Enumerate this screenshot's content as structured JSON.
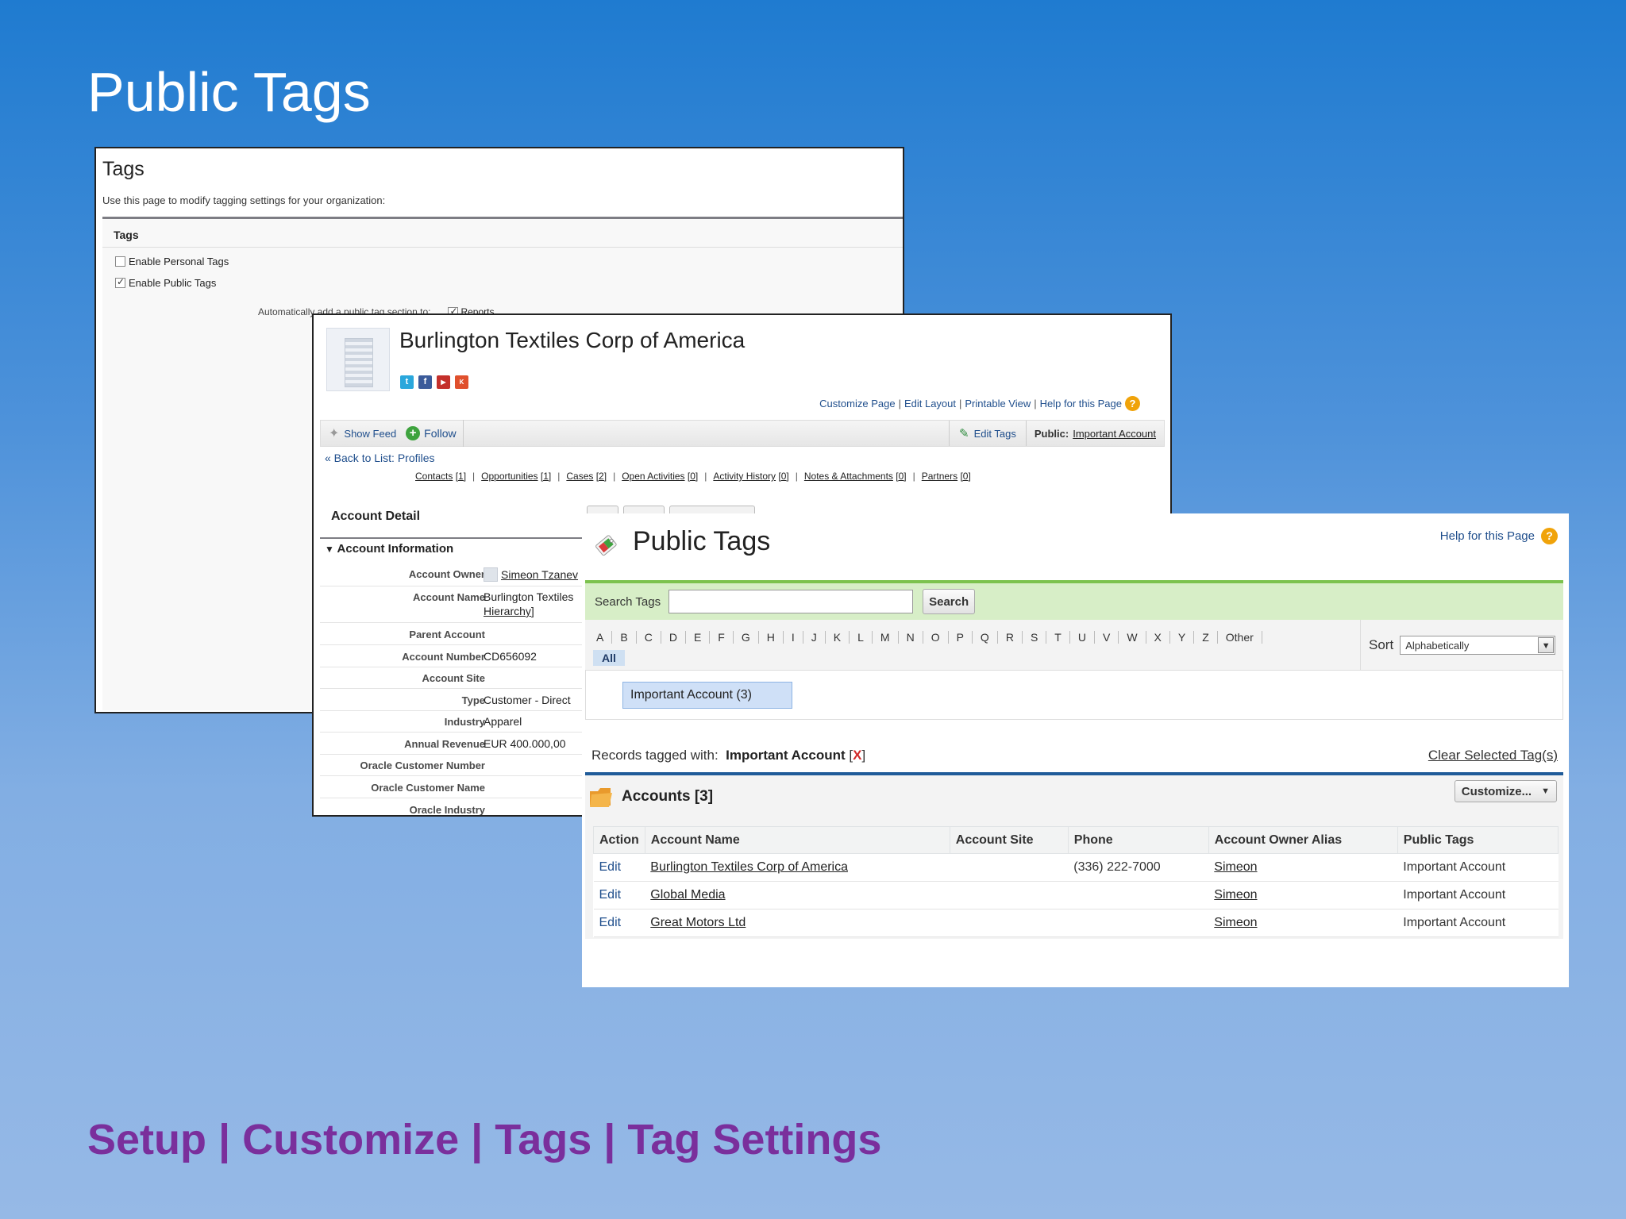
{
  "slide": {
    "title": "Public Tags",
    "footer": "Setup | Customize | Tags | Tag Settings"
  },
  "tag_settings": {
    "title": "Tags",
    "intro": "Use this page to modify tagging settings for your organization:",
    "section": "Tags",
    "personal_label": "Enable Personal Tags",
    "personal_checked": false,
    "public_label": "Enable Public Tags",
    "public_checked": true,
    "auto_label": "Automatically add a public tag section to:",
    "reports_label": "Reports",
    "reports_checked": true
  },
  "account": {
    "name": "Burlington Textiles Corp of America",
    "links": [
      "Customize Page",
      "Edit Layout",
      "Printable View",
      "Help for this Page"
    ],
    "show_feed": "Show Feed",
    "follow": "Follow",
    "edit_tags": "Edit Tags",
    "public_label": "Public:",
    "public_tag": "Important Account",
    "back_to_list": "« Back to List: Profiles",
    "related": [
      {
        "label": "Contacts",
        "count": "[1]"
      },
      {
        "label": "Opportunities",
        "count": "[1]"
      },
      {
        "label": "Cases",
        "count": "[2]"
      },
      {
        "label": "Open Activities",
        "count": "[0]"
      },
      {
        "label": "Activity History",
        "count": "[0]"
      },
      {
        "label": "Notes & Attachments",
        "count": "[0]"
      },
      {
        "label": "Partners",
        "count": "[0]"
      }
    ],
    "detail_title": "Account Detail",
    "info_title": "Account Information",
    "fields": [
      {
        "label": "Account Owner",
        "value": "Simeon Tzanev"
      },
      {
        "label": "Account Name",
        "value": "Burlington Textiles",
        "value2": "Hierarchy]"
      },
      {
        "label": "Parent Account",
        "value": ""
      },
      {
        "label": "Account Number",
        "value": "CD656092"
      },
      {
        "label": "Account Site",
        "value": ""
      },
      {
        "label": "Type",
        "value": "Customer - Direct"
      },
      {
        "label": "Industry",
        "value": "Apparel"
      },
      {
        "label": "Annual Revenue",
        "value": "EUR 400.000,00"
      },
      {
        "label": "Oracle Customer Number",
        "value": ""
      },
      {
        "label": "Oracle Customer Name",
        "value": ""
      },
      {
        "label": "Oracle Industry",
        "value": ""
      }
    ]
  },
  "public_tags": {
    "title": "Public Tags",
    "help": "Help for this Page",
    "search_label": "Search Tags",
    "search_value": "",
    "search_button": "Search",
    "letters": [
      "A",
      "B",
      "C",
      "D",
      "E",
      "F",
      "G",
      "H",
      "I",
      "J",
      "K",
      "L",
      "M",
      "N",
      "O",
      "P",
      "Q",
      "R",
      "S",
      "T",
      "U",
      "V",
      "W",
      "X",
      "Y",
      "Z",
      "Other"
    ],
    "all_label": "All",
    "sort_label": "Sort",
    "sort_value": "Alphabetically",
    "tag_chip": "Important Account (3)",
    "records_label": "Records tagged with:",
    "records_tag": "Important Account",
    "records_open": "[",
    "records_x": "X",
    "records_close": "]",
    "clear_label": "Clear Selected Tag(s)",
    "list_title": "Accounts [3]",
    "customize_label": "Customize...",
    "columns": [
      "Action",
      "Account Name",
      "Account Site",
      "Phone",
      "Account Owner Alias",
      "Public Tags"
    ],
    "rows": [
      {
        "action": "Edit",
        "name": "Burlington Textiles Corp of America",
        "site": "",
        "phone": "(336) 222-7000",
        "owner": "Simeon",
        "tags": "Important Account"
      },
      {
        "action": "Edit",
        "name": "Global Media",
        "site": "",
        "phone": "",
        "owner": "Simeon",
        "tags": "Important Account"
      },
      {
        "action": "Edit",
        "name": "Great Motors Ltd",
        "site": "",
        "phone": "",
        "owner": "Simeon",
        "tags": "Important Account"
      }
    ]
  },
  "colors": {
    "link": "#1f4e8c",
    "footer": "#7a2f9c",
    "search_bar": "#d7eec7",
    "search_bar_border": "#7cc24e",
    "list_border": "#1f5b99"
  }
}
